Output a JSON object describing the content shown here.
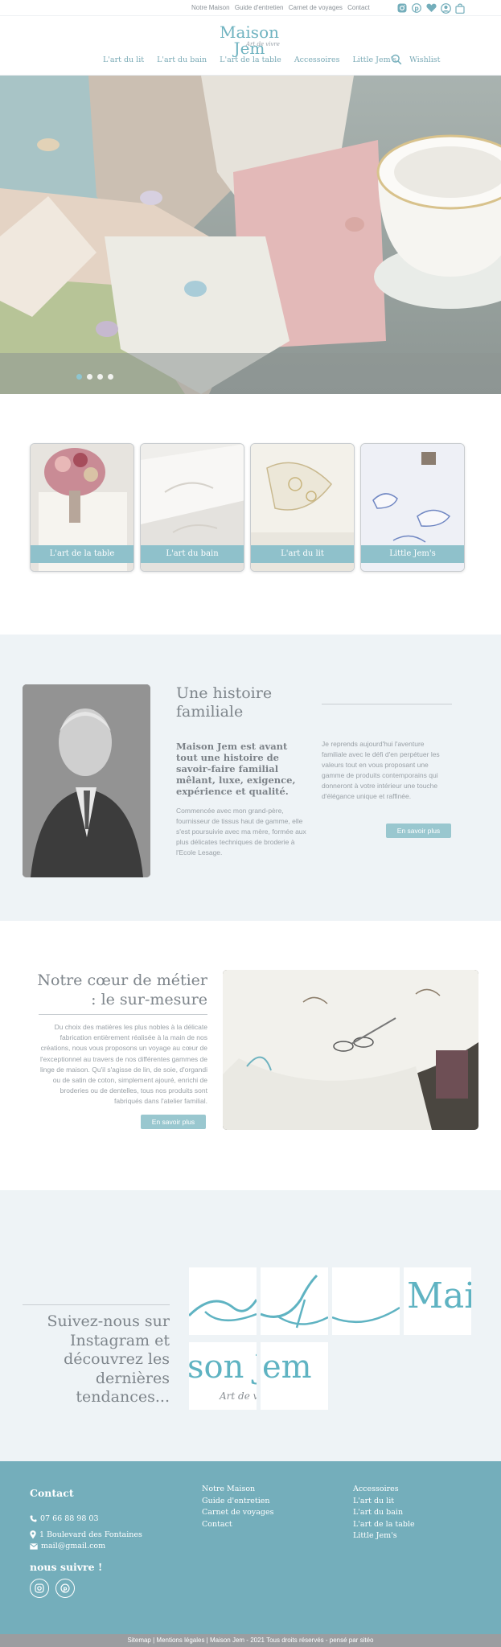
{
  "topbar": {
    "links": [
      "Notre Maison",
      "Guide d'entretien",
      "Carnet de voyages",
      "Contact"
    ],
    "icons": [
      "instagram-icon",
      "pinterest-icon",
      "heart-icon",
      "account-icon",
      "bag-icon"
    ]
  },
  "header": {
    "logo": "Maison Jem",
    "logo_tagline": "Art de vivre",
    "nav": [
      "L'art du lit",
      "L'art du bain",
      "L'art de la table",
      "Accessoires",
      "Little Jem's",
      "Wishlist"
    ]
  },
  "hero": {
    "slides": 4,
    "active_slide": 0
  },
  "categories": [
    "L'art de la table",
    "L'art du bain",
    "L'art du lit",
    "Little Jem's"
  ],
  "history": {
    "title": "Une histoire familiale",
    "lead": "Maison Jem est avant tout une histoire de savoir-faire familial mêlant, luxe, exigence, expérience et qualité.",
    "body": "Commencée avec mon grand-père, fournisseur de tissus haut de gamme, elle s'est poursuivie avec ma mère, formée aux plus délicates techniques de broderie à l'Ecole Lesage.",
    "right": "Je reprends aujourd'hui l'aventure familiale avec le défi d'en perpétuer les valeurs tout en vous proposant une gamme de produits contemporains qui donneront à votre intérieur une touche d'élégance unique et raffinée.",
    "button": "En savoir plus"
  },
  "metier": {
    "title": "Notre cœur de métier : le sur-mesure",
    "body": "Du choix des matières les plus nobles à la délicate fabrication entièrement réalisée à la main de nos créations, nous vous proposons un voyage au cœur de l'exceptionnel au travers de nos différentes gammes de linge de maison. Qu'il s'agisse de lin, de soie, d'organdi ou de satin de coton, simplement ajouré, enrichi de broderies ou de dentelles, tous nos produits sont fabriqués dans l'atelier familial.",
    "button": "En savoir plus"
  },
  "instagram": {
    "text": "Suivez-nous sur Instagram et découvrez les dernières tendances...",
    "tile_mai": "Mai",
    "tile_son": "son J",
    "tile_em": "em",
    "tile_art": "Art de vivre"
  },
  "footer": {
    "contact_title": "Contact",
    "phone": "07 66 88 98 03",
    "address": "1 Boulevard des Fontaines",
    "email": "mail@gmail.com",
    "follow_title": "nous suivre !",
    "col1": [
      "Notre Maison",
      "Guide d'entretien",
      "Carnet de voyages",
      "Contact"
    ],
    "col2": [
      "Accessoires",
      "L'art du lit",
      "L'art du bain",
      "L'art de la table",
      "Little Jem's"
    ],
    "bottom": "Sitemap | Mentions légales |  Maison Jem - 2021 Tous droits réservés - pensé par sitéo"
  },
  "colors": {
    "accent": "#74aebb",
    "button": "#99c7cf",
    "section_bg": "#eef3f6"
  }
}
